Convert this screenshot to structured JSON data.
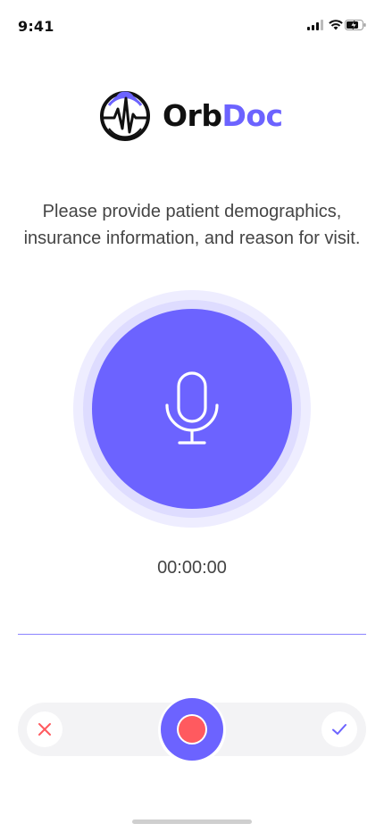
{
  "status_bar": {
    "time": "9:41",
    "icons": [
      "cellular-signal-icon",
      "wifi-icon",
      "battery-charging-icon"
    ]
  },
  "logo": {
    "part1": "Orb",
    "part2": "Doc",
    "icon": "orb-heartbeat-icon"
  },
  "prompt": {
    "line1": "Please provide patient demographics,",
    "line2": "insurance information, and reason for visit."
  },
  "recorder": {
    "mic_icon": "microphone-icon",
    "timer": "00:00:00"
  },
  "controls": {
    "cancel_icon": "close-icon",
    "record_icon": "record-icon",
    "confirm_icon": "checkmark-icon"
  },
  "colors": {
    "accent": "#6c63ff",
    "record": "#ff5a5f",
    "cancel": "#ff5a5f",
    "bar_bg": "#f3f3f5"
  }
}
